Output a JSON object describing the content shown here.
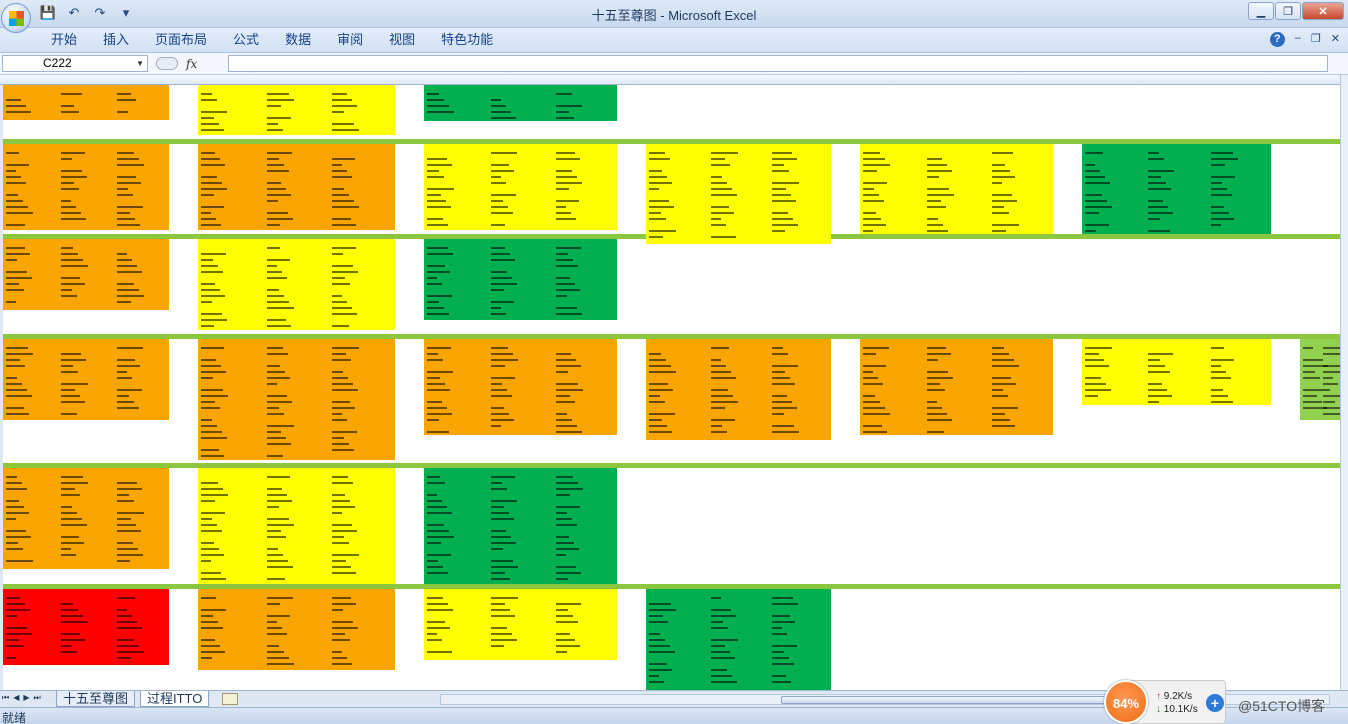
{
  "window": {
    "title": "十五至尊图 - Microsoft Excel"
  },
  "ribbon": {
    "tabs": [
      "开始",
      "插入",
      "页面布局",
      "公式",
      "数据",
      "审阅",
      "视图",
      "特色功能"
    ]
  },
  "formula_bar": {
    "name_box": "C222",
    "fx_label": "fx",
    "formula": ""
  },
  "sheet_tabs": [
    "十五至尊图",
    "过程ITTO"
  ],
  "status": {
    "ready": "就绪"
  },
  "network": {
    "cpu": "84%",
    "up": "9.2K/s",
    "down": "10.1K/s"
  },
  "watermark": "@51CTO博客",
  "colors": {
    "orange": "#f9a500",
    "yellow": "#ffff00",
    "green": "#00b050",
    "red": "#ff0000",
    "light_green": "#92d050"
  }
}
